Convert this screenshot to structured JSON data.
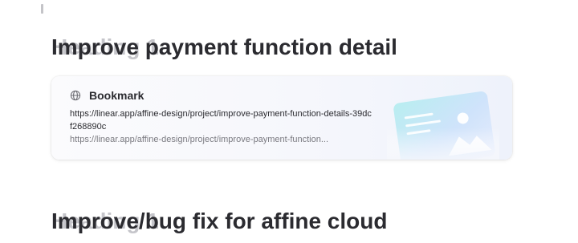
{
  "blocks": [
    {
      "type": "heading",
      "placeholder": "Heading 1",
      "text": "Improve payment function detail"
    },
    {
      "type": "bookmark",
      "icon": "globe-icon",
      "title": "Bookmark",
      "description": "https://linear.app/affine-design/project/improve-payment-function-details-39dcf268890c",
      "url": "https://linear.app/affine-design/project/improve-payment-function..."
    },
    {
      "type": "heading",
      "placeholder": "Heading 1",
      "text": "Improve/bug fix for affine cloud"
    }
  ],
  "colors": {
    "text": "#2b2b30",
    "muted": "#7a7a80",
    "card_bg": "#f6f7fc",
    "illustration_accent": "#5fc9d8"
  }
}
